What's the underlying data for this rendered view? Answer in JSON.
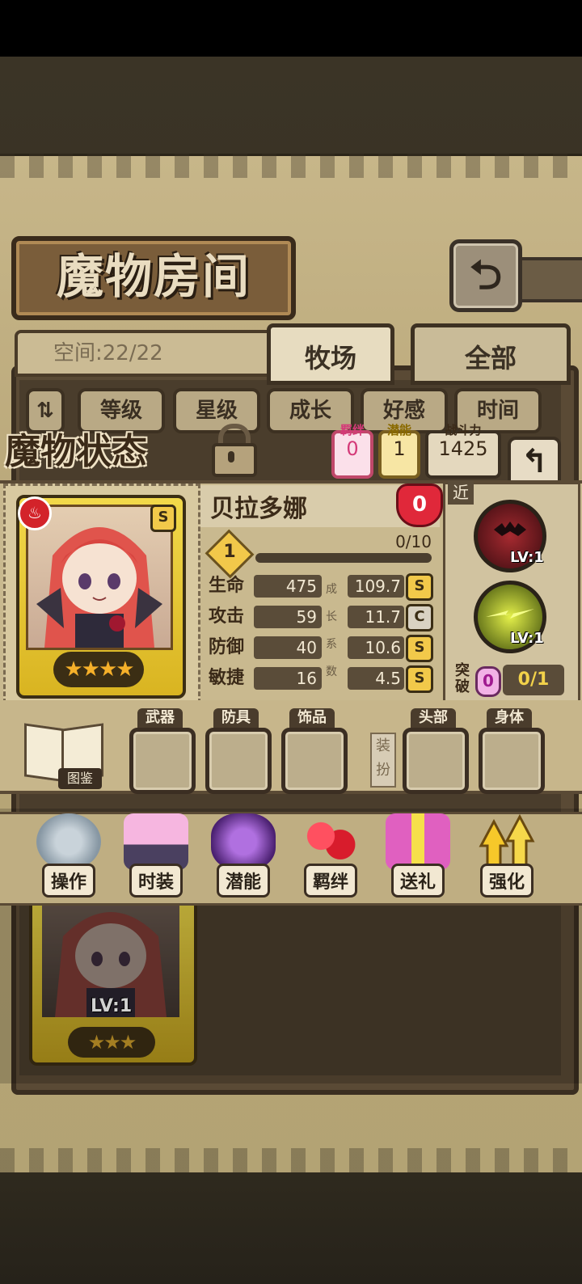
{
  "header": {
    "title": "魔物房间",
    "back_icon": "return-arrow-icon"
  },
  "room": {
    "space_label": "空间:22/22",
    "tabs": [
      {
        "label": "牧场",
        "active": true
      },
      {
        "label": "全部",
        "active": false
      }
    ],
    "sort_buttons": [
      "等级",
      "星级",
      "成长",
      "好感",
      "时间"
    ]
  },
  "status": {
    "title": "魔物状态",
    "bond_label": "羁绊",
    "bond_value": "0",
    "potential_label": "潜能",
    "potential_value": "1",
    "power_label": "战斗力",
    "power_value": "1425",
    "card": {
      "element": "fire",
      "rank": "S",
      "stars": "★★★★"
    },
    "name": "贝拉多娜",
    "affection": "0",
    "level": "1",
    "exp": "0/10",
    "stats": [
      {
        "label": "生命",
        "value": "475",
        "growth": "109.7",
        "grade": "S"
      },
      {
        "label": "攻击",
        "value": "59",
        "growth": "11.7",
        "grade": "C"
      },
      {
        "label": "防御",
        "value": "40",
        "growth": "10.6",
        "grade": "S"
      },
      {
        "label": "敏捷",
        "value": "16",
        "growth": "4.5",
        "grade": "S"
      }
    ],
    "growth_vertical": [
      "成",
      "长",
      "系",
      "数"
    ],
    "range": "近",
    "skills": [
      {
        "name": "bat-skill-icon",
        "level": "LV:1"
      },
      {
        "name": "lightning-skill-icon",
        "level": "LV:1"
      }
    ],
    "breakthrough_label_1": "突",
    "breakthrough_label_2": "破",
    "breakthrough_gem": "0",
    "breakthrough_value": "0/1"
  },
  "equipment": {
    "book_label": "图鉴",
    "slots": [
      "武器",
      "防具",
      "饰品",
      "头部",
      "身体"
    ],
    "dress_label_1": "装",
    "dress_label_2": "扮"
  },
  "actions": [
    {
      "label": "操作",
      "icon": "gear-icon"
    },
    {
      "label": "时装",
      "icon": "outfit-icon"
    },
    {
      "label": "潜能",
      "icon": "demon-potential-icon"
    },
    {
      "label": "羁绊",
      "icon": "hearts-icon"
    },
    {
      "label": "送礼",
      "icon": "gift-icon"
    },
    {
      "label": "强化",
      "icon": "upgrade-arrows-icon"
    }
  ],
  "background_card": {
    "level": "LV:1",
    "stars": "★★★"
  },
  "colors": {
    "parchment": "#c7b689",
    "frame_dark": "#3a2e20",
    "bond_pink": "#d43a78",
    "grade_gold": "#f2c94a"
  }
}
